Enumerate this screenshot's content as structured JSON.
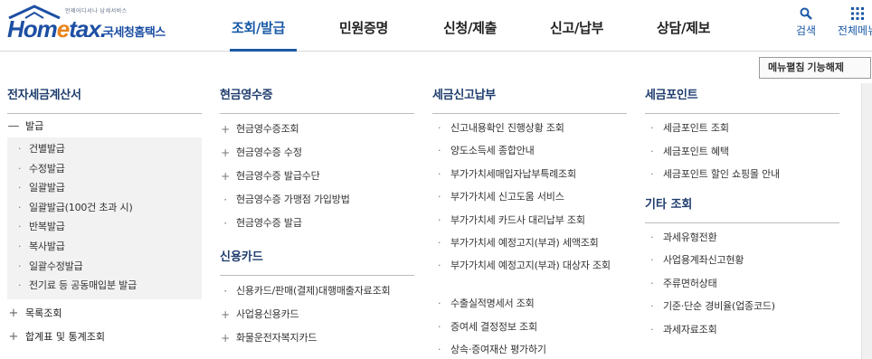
{
  "logo": {
    "tagline": "언제어디서나 납세서비스",
    "brand_home": "Hom",
    "brand_e": "e",
    "brand_tax": "tax.",
    "brand_kr": "국세청홈택스"
  },
  "gnb": [
    {
      "label": "조회/발급",
      "active": true
    },
    {
      "label": "민원증명",
      "active": false
    },
    {
      "label": "신청/제출",
      "active": false
    },
    {
      "label": "신고/납부",
      "active": false
    },
    {
      "label": "상담/제보",
      "active": false
    }
  ],
  "util": {
    "search_label": "검색",
    "all_menu_label": "전체메뉴"
  },
  "collapse_button": "메뉴펼침 기능해제",
  "col1": {
    "title": "전자세금계산서",
    "group_issue": {
      "marker": "—",
      "label": "발급"
    },
    "issue_items": [
      "건별발급",
      "수정발급",
      "일괄발급",
      "일괄발급(100건 초과 시)",
      "반복발급",
      "복사발급",
      "일괄수정발급",
      "전기료 등 공동매입분 발급"
    ],
    "other_groups": [
      {
        "marker": "+",
        "label": "목록조회"
      },
      {
        "marker": "+",
        "label": "합계표 및 통계조회"
      }
    ]
  },
  "col2": {
    "title": "현금영수증",
    "items": [
      {
        "marker": "+",
        "label": "현금영수증조회"
      },
      {
        "marker": "+",
        "label": "현금영수증 수정"
      },
      {
        "marker": "+",
        "label": "현금영수증 발급수단"
      },
      {
        "marker": "·",
        "label": "현금영수증 가맹점 가입방법"
      },
      {
        "marker": "·",
        "label": "현금영수증 발급"
      }
    ],
    "title2": "신용카드",
    "items2": [
      {
        "marker": "·",
        "label": "신용카드/판매(결제)대행매출자료조회"
      },
      {
        "marker": "+",
        "label": "사업용신용카드"
      },
      {
        "marker": "+",
        "label": "화물운전자복지카드"
      }
    ]
  },
  "col3": {
    "title": "세금신고납부",
    "items": [
      "신고내용확인 진행상황 조회",
      "양도소득세 종합안내",
      "부가가치세매입자납부특례조회",
      "부가가치세 신고도움 서비스",
      "부가가치세 카드사 대리납부 조회",
      "부가가치세 예정고지(부과) 세액조회",
      "부가가치세 예정고지(부과) 대상자 조회",
      "수출실적명세서 조회",
      "증여세 결정정보 조회",
      "상속·증여재산 평가하기"
    ]
  },
  "col4": {
    "title": "세금포인트",
    "items": [
      "세금포인트 조회",
      "세금포인트 혜택",
      "세금포인트 할인 쇼핑몰 안내"
    ],
    "title2": "기타 조회",
    "items2": [
      "과세유형전환",
      "사업용계좌신고현황",
      "주류면허상태",
      "기준·단순 경비율(업종코드)",
      "과세자료조회"
    ]
  },
  "colors": {
    "brand_blue": "#1d4fa3",
    "accent_orange": "#e8841d",
    "active_menu": "#1a5aa6",
    "column_title": "#1f3d6e"
  },
  "icons": [
    "search-icon",
    "grid-menu-icon",
    "house-roof-icon",
    "minus-icon",
    "plus-icon",
    "bullet-dot-icon"
  ]
}
